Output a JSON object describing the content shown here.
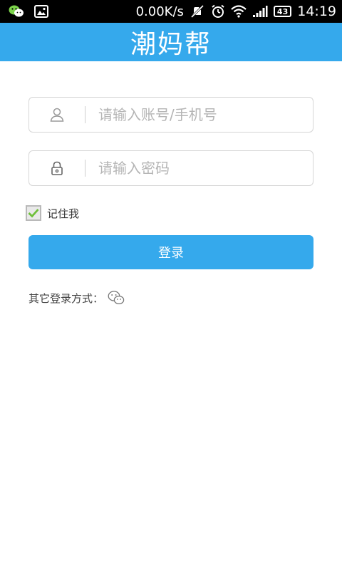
{
  "status_bar": {
    "network_speed": "0.00K/s",
    "battery_level": "43",
    "time": "14:19",
    "icons": [
      "wechat-icon",
      "image-icon",
      "mute-icon",
      "alarm-icon",
      "wifi-icon",
      "signal-icon",
      "battery-icon"
    ]
  },
  "header": {
    "title": "潮妈帮"
  },
  "login_form": {
    "username_placeholder": "请输入账号/手机号",
    "password_placeholder": "请输入密码",
    "remember_label": "记住我",
    "remember_checked": true,
    "login_label": "登录",
    "other_login_label": "其它登录方式："
  },
  "colors": {
    "accent": "#35a9ec",
    "status_bar": "#000000",
    "background": "#ffffff",
    "checkbox_check": "#6fbf3a"
  }
}
